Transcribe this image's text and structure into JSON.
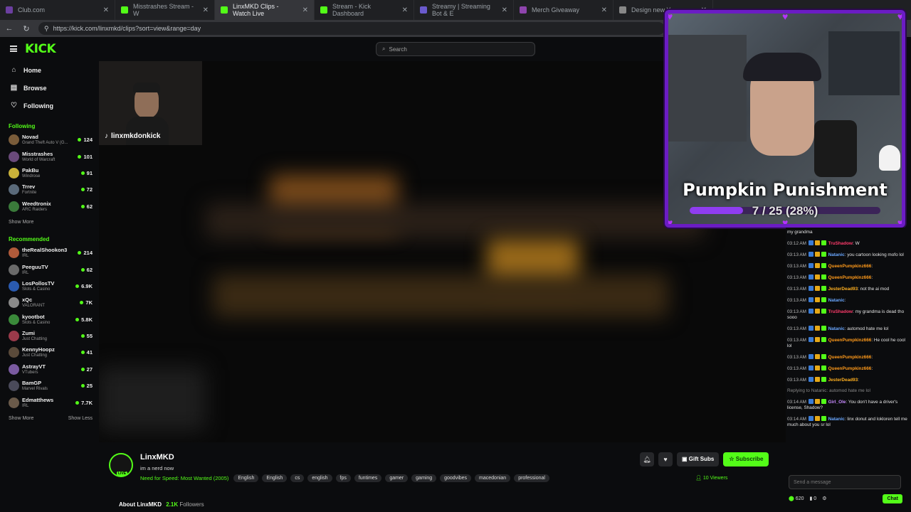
{
  "browser": {
    "tabs": [
      {
        "label": "Club.com",
        "color": "#6b3fa0",
        "active": false
      },
      {
        "label": "Misstrashes Stream - W",
        "color": "#53fc18",
        "active": false
      },
      {
        "label": "LinxMKD Clips - Watch Live",
        "color": "#53fc18",
        "active": true
      },
      {
        "label": "Stream - Kick Dashboard",
        "color": "#53fc18",
        "active": false
      },
      {
        "label": "Streamy | Streaming Bot & E",
        "color": "#6a5acd",
        "active": false
      },
      {
        "label": "Merch Giveaway",
        "color": "#8e44ad",
        "active": false
      },
      {
        "label": "Design new Y",
        "color": "#888888",
        "active": false
      }
    ],
    "url": "https://kick.com/linxmkd/clips?sort=view&range=day"
  },
  "kick": {
    "logo": "KICK",
    "search_placeholder": "Search"
  },
  "sidebar": {
    "nav": [
      {
        "label": "Home",
        "icon": "home-icon",
        "glyph": "⌂"
      },
      {
        "label": "Browse",
        "icon": "browse-icon",
        "glyph": "▤"
      },
      {
        "label": "Following",
        "icon": "heart-icon",
        "glyph": "♡"
      }
    ],
    "following_title": "Following",
    "following": [
      {
        "name": "Novad",
        "game": "Grand Theft Auto V (G...",
        "count": "124",
        "color": "#7a5c3a"
      },
      {
        "name": "Misstrashes",
        "game": "World of Warcraft",
        "count": "101",
        "color": "#6a4a7a"
      },
      {
        "name": "PakBu",
        "game": "Windrose",
        "count": "91",
        "color": "#c9b23a"
      },
      {
        "name": "Trrev",
        "game": "Fortnite",
        "count": "72",
        "color": "#5a6a7a"
      },
      {
        "name": "Weedtronix",
        "game": "ARC Raiders",
        "count": "62",
        "color": "#3a7a3a"
      }
    ],
    "show_more": "Show More",
    "recommended_title": "Recommended",
    "recommended": [
      {
        "name": "theRealShookon3",
        "game": "IRL",
        "count": "214",
        "color": "#b05a3a"
      },
      {
        "name": "PeeguuTV",
        "game": "IRL",
        "count": "62",
        "color": "#6a6a6a"
      },
      {
        "name": "LosPollosTV",
        "game": "Slots & Casino",
        "count": "6.9K",
        "color": "#2a5ab0"
      },
      {
        "name": "xQc",
        "game": "VALORANT",
        "count": "7K",
        "color": "#8a8a8a"
      },
      {
        "name": "kyootbot",
        "game": "Slots & Casino",
        "count": "5.8K",
        "color": "#3a8a3a"
      },
      {
        "name": "Zumi",
        "game": "Just Chatting",
        "count": "55",
        "color": "#9a3a4a"
      },
      {
        "name": "KennyHoopz",
        "game": "Just Chatting",
        "count": "41",
        "color": "#5a4a3a"
      },
      {
        "name": "AstrayVT",
        "game": "VTubers",
        "count": "27",
        "color": "#7a5aa0"
      },
      {
        "name": "BamGP",
        "game": "Marvel Rivals",
        "count": "25",
        "color": "#4a4a5a"
      },
      {
        "name": "Edmatthews",
        "game": "IRL",
        "count": "7.7K",
        "color": "#6a5a4a"
      }
    ],
    "show_less": "Show Less"
  },
  "video": {
    "handle": "linxmkdonkick"
  },
  "overlay": {
    "title": "Pumpkin Punishment",
    "progress_text": "7 / 25 (28%)",
    "progress_fraction": 0.28
  },
  "chat": {
    "messages": [
      {
        "time": "",
        "user": "",
        "color": "#e4e4e4",
        "text": "my grandma"
      },
      {
        "time": "03:12 AM",
        "user": "TruShadow",
        "color": "#ff3b6b",
        "text": ": W"
      },
      {
        "time": "03:13 AM",
        "user": "Natanic",
        "color": "#6aa7ff",
        "text": ": you cartoon looking mofo lol"
      },
      {
        "time": "03:13 AM",
        "user": "QueenPumpkinz666",
        "color": "#ff9a1a",
        "text": ":"
      },
      {
        "time": "03:13 AM",
        "user": "QueenPumpkinz666",
        "color": "#ff9a1a",
        "text": ":"
      },
      {
        "time": "03:13 AM",
        "user": "JesterDead93",
        "color": "#ffb020",
        "text": ": not the ai mod"
      },
      {
        "time": "03:13 AM",
        "user": "Natanic",
        "color": "#6aa7ff",
        "text": ":"
      },
      {
        "time": "03:13 AM",
        "user": "TruShadow",
        "color": "#ff3b6b",
        "text": ": my grandma is dead tho sooo"
      },
      {
        "time": "03:13 AM",
        "user": "Natanic",
        "color": "#6aa7ff",
        "text": ": automod hate me lol"
      },
      {
        "time": "03:13 AM",
        "user": "QueenPumpkinz666",
        "color": "#ff9a1a",
        "text": ": He cool he cool lol"
      },
      {
        "time": "03:13 AM",
        "user": "QueenPumpkinz666",
        "color": "#ff9a1a",
        "text": ":"
      },
      {
        "time": "03:13 AM",
        "user": "QueenPumpkinz666",
        "color": "#ff9a1a",
        "text": ":"
      },
      {
        "time": "03:13 AM",
        "user": "JesterDead93",
        "color": "#ffb020",
        "text": ":"
      },
      {
        "time": "03:14 AM",
        "user": "Girl_Ole",
        "color": "#c88bff",
        "text": ": You don't have a driver's license, Shadow?"
      },
      {
        "time": "03:14 AM",
        "user": "Natanic",
        "color": "#6aa7ff",
        "text": ": linx donut and lokloren tell me much about you sr lol"
      }
    ],
    "reply_hint": "Replying to Natanic: automod hate me lol",
    "input_placeholder": "Send a message",
    "points": "620",
    "zero": "0",
    "chat_button": "Chat"
  },
  "channel": {
    "name": "LinxMKD",
    "live_label": "LIVE",
    "title": "im a nerd now",
    "game": "Need for Speed: Most Wanted (2005)",
    "tags": [
      "English",
      "English",
      "cs",
      "english",
      "fps",
      "funtimes",
      "gamer",
      "gaming",
      "goodvibes",
      "macedonian",
      "professional"
    ],
    "gift_subs": "Gift Subs",
    "subscribe": "Subscribe",
    "viewers": "10 Viewers",
    "about": "About LinxMKD",
    "followers_count": "2.1K",
    "followers_label": "Followers"
  }
}
